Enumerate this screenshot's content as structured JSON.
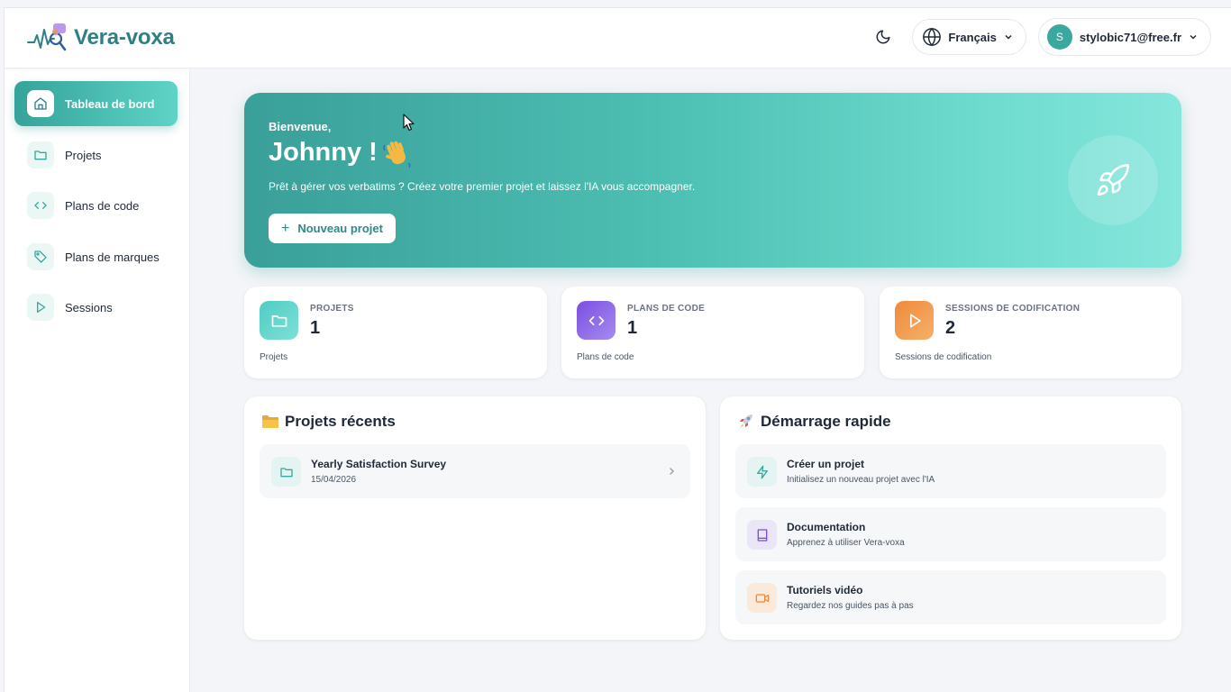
{
  "header": {
    "app_name": "Vera-voxa",
    "language": "Français",
    "user_initial": "S",
    "user_email": "stylobic71@free.fr"
  },
  "sidebar": {
    "items": [
      {
        "label": "Tableau de bord",
        "icon": "home-icon",
        "active": true
      },
      {
        "label": "Projets",
        "icon": "folder-icon",
        "active": false
      },
      {
        "label": "Plans de code",
        "icon": "code-icon",
        "active": false
      },
      {
        "label": "Plans de marques",
        "icon": "tag-icon",
        "active": false
      },
      {
        "label": "Sessions",
        "icon": "play-icon",
        "active": false
      }
    ]
  },
  "hero": {
    "welcome": "Bienvenue,",
    "name": "Johnny !",
    "description": "Prêt à gérer vos verbatims ? Créez votre premier projet et laissez l'IA vous accompagner.",
    "new_project_label": "Nouveau projet"
  },
  "stats": [
    {
      "title": "PROJETS",
      "value": "1",
      "subtitle": "Projets",
      "color": "#4ecdc4"
    },
    {
      "title": "PLANS DE CODE",
      "value": "1",
      "subtitle": "Plans de code",
      "color": "#8b5cf6"
    },
    {
      "title": "SESSIONS DE CODIFICATION",
      "value": "2",
      "subtitle": "Sessions de codification",
      "color": "#f0954a"
    }
  ],
  "recent_projects": {
    "title": "Projets récents",
    "items": [
      {
        "name": "Yearly Satisfaction Survey",
        "date": "15/04/2026"
      }
    ]
  },
  "quick_start": {
    "title": "Démarrage rapide",
    "items": [
      {
        "title": "Créer un projet",
        "subtitle": "Initialisez un nouveau projet avec l'IA",
        "icon": "lightning-icon"
      },
      {
        "title": "Documentation",
        "subtitle": "Apprenez à utiliser Vera-voxa",
        "icon": "book-icon"
      },
      {
        "title": "Tutoriels vidéo",
        "subtitle": "Regardez nos guides pas à pas",
        "icon": "video-icon"
      }
    ]
  },
  "colors": {
    "brand": "#2f7f85",
    "accent": "#3aa89e"
  }
}
